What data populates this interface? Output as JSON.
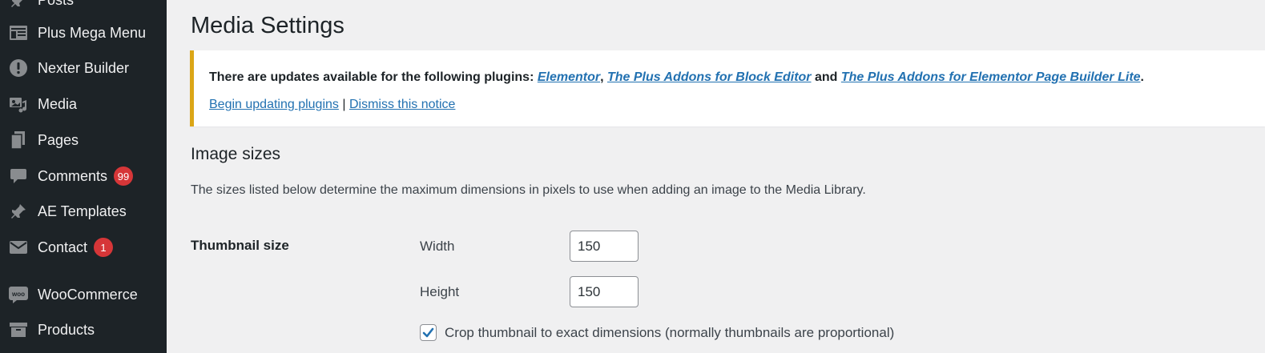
{
  "sidebar": {
    "items": [
      {
        "label": "Posts",
        "icon": "pin-icon"
      },
      {
        "label": "Plus Mega Menu",
        "icon": "mega-menu-icon"
      },
      {
        "label": "Nexter Builder",
        "icon": "info-circle-icon"
      },
      {
        "label": "Media",
        "icon": "media-icon"
      },
      {
        "label": "Pages",
        "icon": "pages-icon"
      },
      {
        "label": "Comments",
        "icon": "comment-icon",
        "badge": "99"
      },
      {
        "label": "AE Templates",
        "icon": "pin-icon"
      },
      {
        "label": "Contact",
        "icon": "mail-icon",
        "badge": "1"
      },
      {
        "label": "WooCommerce",
        "icon": "woo-icon",
        "icon_text": "woo"
      },
      {
        "label": "Products",
        "icon": "archive-icon"
      }
    ]
  },
  "page": {
    "title": "Media Settings"
  },
  "notice": {
    "text_prefix": "There are updates available for the following plugins: ",
    "link_1": "Elementor",
    "sep_1": ", ",
    "link_2": "The Plus Addons for Block Editor",
    "sep_2": " and ",
    "link_3": "The Plus Addons for Elementor Page Builder Lite",
    "text_suffix": ".",
    "begin_updating": "Begin updating plugins",
    "separator": " | ",
    "dismiss": "Dismiss this notice"
  },
  "image_sizes": {
    "title": "Image sizes",
    "description": "The sizes listed below determine the maximum dimensions in pixels to use when adding an image to the Media Library.",
    "thumbnail": {
      "label": "Thumbnail size",
      "width_label": "Width",
      "width_value": "150",
      "height_label": "Height",
      "height_value": "150",
      "crop_label": "Crop thumbnail to exact dimensions (normally thumbnails are proportional)",
      "crop_checked": true
    }
  },
  "colors": {
    "sidebar_bg": "#1d2327",
    "accent": "#2271b1",
    "warning": "#dba617",
    "badge": "#d63638"
  }
}
